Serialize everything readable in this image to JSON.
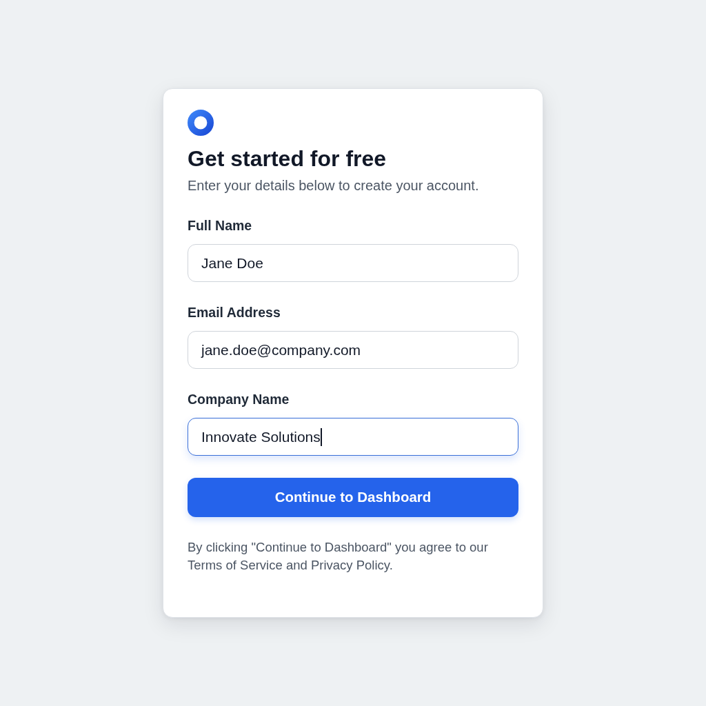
{
  "heading": {
    "title": "Get started for free",
    "subtitle": "Enter your details below to create your account."
  },
  "fields": [
    {
      "label": "Full Name",
      "value": "Jane Doe",
      "focused": false
    },
    {
      "label": "Email Address",
      "value": "jane.doe@company.com",
      "focused": false
    },
    {
      "label": "Company Name",
      "value": "Innovate Solutions",
      "focused": true
    }
  ],
  "submit_button": {
    "label": "Continue to Dashboard"
  },
  "terms": "By clicking \"Continue to Dashboard\" you agree to our Terms of Service and Privacy Policy."
}
